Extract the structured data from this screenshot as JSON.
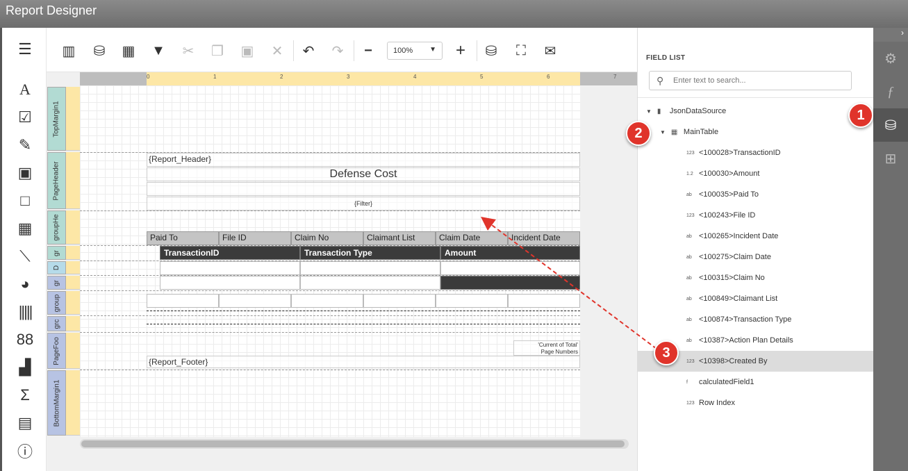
{
  "app": {
    "title": "Report Designer"
  },
  "toolbar": {
    "zoom": "100%"
  },
  "left_tools": [
    "menu-icon",
    "label-icon",
    "checkbox-icon",
    "rich-text-icon",
    "picture-icon",
    "panel-icon",
    "table-icon",
    "line-icon",
    "shape-icon",
    "barcode-icon",
    "gauge-icon",
    "chart-icon",
    "sum-icon",
    "subreport-icon",
    "toc-icon"
  ],
  "bands": [
    "TopMargin1",
    "PageHeader",
    "groupHe",
    "gr",
    "D",
    "gr",
    "group",
    "grc",
    "PageFoo",
    "BottomMargin1"
  ],
  "ruler": {
    "ticks": [
      "0",
      "1",
      "2",
      "3",
      "4",
      "5",
      "6",
      "7"
    ]
  },
  "report": {
    "report_header": "{Report_Header}",
    "title": "Defense Cost",
    "filter": "{Filter}",
    "group_columns": [
      "Paid To",
      "File ID",
      "Claim No",
      "Claimant List",
      "Claim Date",
      "Incident Date"
    ],
    "detail_columns": [
      "TransactionID",
      "Transaction Type",
      "Amount"
    ],
    "page_numbers_line1": "'Current of Total'",
    "page_numbers_line2": "Page Numbers",
    "report_footer": "{Report_Footer}"
  },
  "field_list": {
    "title": "FIELD LIST",
    "search_placeholder": "Enter text to search...",
    "datasource": "JsonDataSource",
    "table": "MainTable",
    "fields": [
      {
        "type": "123",
        "name": "<100028>TransactionID"
      },
      {
        "type": "1.2",
        "name": "<100030>Amount"
      },
      {
        "type": "ab",
        "name": "<100035>Paid To"
      },
      {
        "type": "123",
        "name": "<100243>File ID"
      },
      {
        "type": "ab",
        "name": "<100265>Incident Date"
      },
      {
        "type": "ab",
        "name": "<100275>Claim Date"
      },
      {
        "type": "ab",
        "name": "<100315>Claim No"
      },
      {
        "type": "ab",
        "name": "<100849>Claimant List"
      },
      {
        "type": "ab",
        "name": "<100874>Transaction Type"
      },
      {
        "type": "ab",
        "name": "<10387>Action Plan Details"
      },
      {
        "type": "123",
        "name": "<10398>Created By"
      },
      {
        "type": "f",
        "name": "calculatedField1"
      },
      {
        "type": "123",
        "name": "Row Index"
      }
    ]
  },
  "callouts": [
    "1",
    "2",
    "3"
  ],
  "colors": {
    "callout": "#e0342b",
    "ruler": "#fde7a6",
    "band_header": "#c4c4c4",
    "detail_header": "#3b3b3b"
  }
}
